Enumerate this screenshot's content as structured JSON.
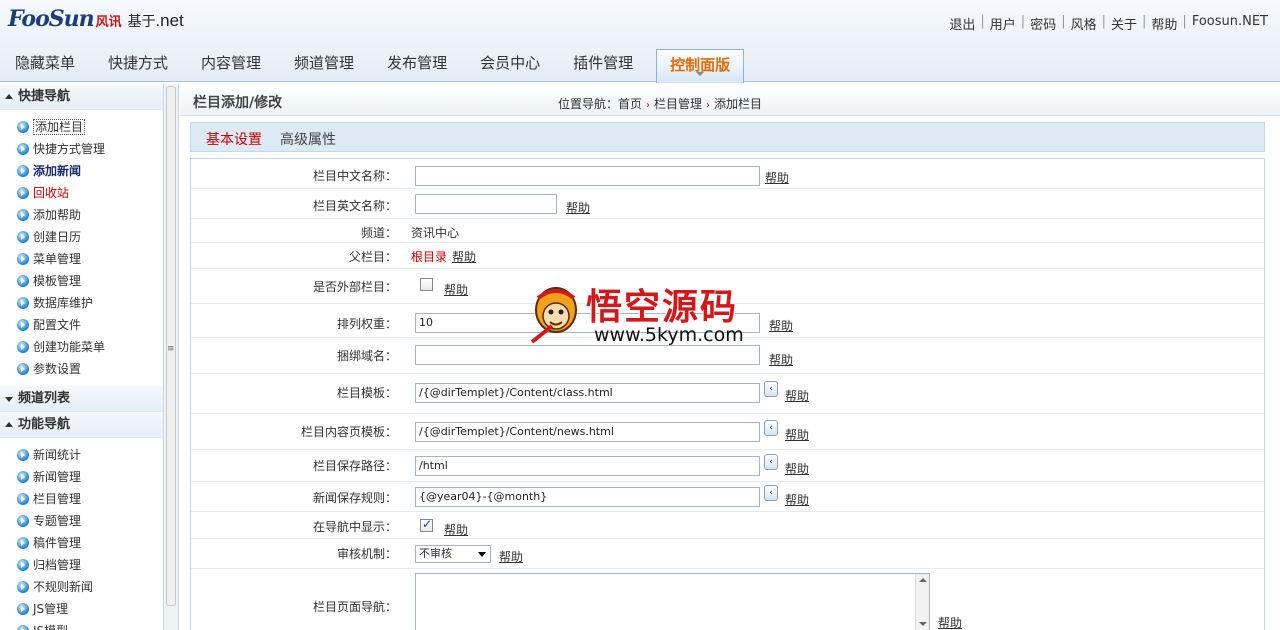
{
  "header": {
    "logo_main": "FooSun",
    "logo_cn": "风讯",
    "logo_base": "基于.",
    "logo_net": "net",
    "links": [
      "退出",
      "用户",
      "密码",
      "风格",
      "关于",
      "帮助",
      "Foosun.NET"
    ]
  },
  "nav": {
    "items": [
      "隐藏菜单",
      "快捷方式",
      "内容管理",
      "频道管理",
      "发布管理",
      "会员中心",
      "插件管理",
      "控制面版"
    ],
    "active": "控制面版"
  },
  "sidebar": {
    "sections": [
      {
        "title": "快捷导航",
        "expanded": true,
        "items": [
          "添加栏目",
          "快捷方式管理",
          "添加新闻",
          "回收站",
          "添加帮助",
          "创建日历",
          "菜单管理",
          "模板管理",
          "数据库维护",
          "配置文件",
          "创建功能菜单",
          "参数设置"
        ]
      },
      {
        "title": "频道列表",
        "expanded": false,
        "items": []
      },
      {
        "title": "功能导航",
        "expanded": true,
        "items": [
          "新闻统计",
          "新闻管理",
          "栏目管理",
          "专题管理",
          "稿件管理",
          "归档管理",
          "不规则新闻",
          "JS管理",
          "JS模型"
        ]
      }
    ]
  },
  "main": {
    "title": "栏目添加/修改",
    "breadcrumb_prefix": "位置导航：",
    "breadcrumb": [
      "首页",
      "栏目管理",
      "添加栏目"
    ],
    "tabs": [
      "基本设置",
      "高级属性"
    ],
    "help_label": "帮助",
    "fields": {
      "cn_name": {
        "label": "栏目中文名称：",
        "value": ""
      },
      "en_name": {
        "label": "栏目英文名称：",
        "value": ""
      },
      "channel": {
        "label": "频道：",
        "value": "资讯中心"
      },
      "parent": {
        "label": "父栏目：",
        "value": "根目录"
      },
      "external": {
        "label": "是否外部栏目：",
        "checked": false
      },
      "order": {
        "label": "排列权重：",
        "value": "10"
      },
      "domain": {
        "label": "捆绑域名：",
        "value": ""
      },
      "template": {
        "label": "栏目模板：",
        "value": "/{@dirTemplet}/Content/class.html"
      },
      "content_template": {
        "label": "栏目内容页模板：",
        "value": "/{@dirTemplet}/Content/news.html"
      },
      "save_path": {
        "label": "栏目保存路径：",
        "value": "/html"
      },
      "news_rule": {
        "label": "新闻保存规则：",
        "value": "{@year04}-{@month}"
      },
      "show_in_nav": {
        "label": "在导航中显示：",
        "checked": true
      },
      "audit": {
        "label": "审核机制：",
        "value": "不审核"
      },
      "page_nav": {
        "label": "栏目页面导航：",
        "value": ""
      }
    }
  },
  "watermark": {
    "title": "悟空源码",
    "url": "www.5kym.com"
  },
  "colors": {
    "accent_orange": "#e36c09",
    "red": "#c00000",
    "nav_bg": "#e4edf6"
  }
}
